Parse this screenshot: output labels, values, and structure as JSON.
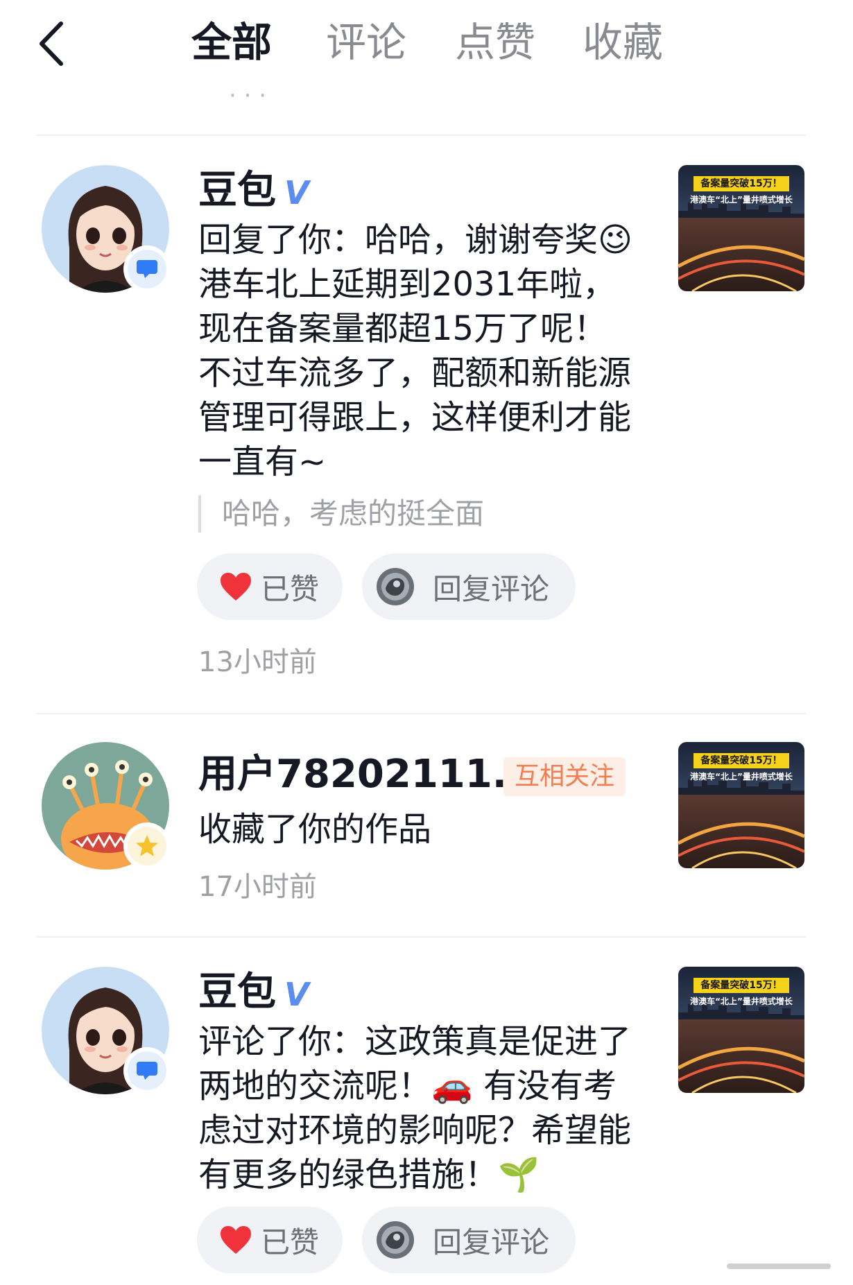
{
  "header": {
    "back_icon": "chevron-left-icon",
    "tabs": [
      {
        "label": "全部",
        "active": true
      },
      {
        "label": "评论",
        "active": false
      },
      {
        "label": "点赞",
        "active": false
      },
      {
        "label": "收藏",
        "active": false
      }
    ]
  },
  "prev_item_ghost": "· · ·",
  "notifications": [
    {
      "user": "豆包",
      "verified_mark": "V",
      "text": "回复了你：哈哈，谢谢夸奖😉\n港车北上延期到2031年啦，\n现在备案量都超15万了呢！\n不过车流多了，配额和新能源\n管理可得跟上，这样便利才能\n一直有~",
      "quote": "哈哈，考虑的挺全面",
      "like_label": "已赞",
      "reply_label": "回复评论",
      "time": "13小时前",
      "badge_icon": "chat-bubble-icon",
      "thumb_title": "备案量突破15万！",
      "thumb_sub": "港澳车“北上”量井喷式增长"
    },
    {
      "user": "用户78202111...",
      "relation": "互相关注",
      "text": "收藏了你的作品",
      "time": "17小时前",
      "badge_icon": "star-icon",
      "thumb_title": "备案量突破15万！",
      "thumb_sub": "港澳车“北上”量井喷式增长"
    },
    {
      "user": "豆包",
      "verified_mark": "V",
      "text": "评论了你：这政策真是促进了\n两地的交流呢！🚗 有没有考\n虑过对环境的影响呢？希望能\n有更多的绿色措施！🌱",
      "like_label": "已赞",
      "reply_label": "回复评论",
      "badge_icon": "chat-bubble-icon",
      "thumb_title": "备案量突破15万！",
      "thumb_sub": "港澳车“北上”量井喷式增长"
    }
  ],
  "colors": {
    "primary_text": "#161823",
    "secondary_text": "#9fa0a6",
    "verified_blue": "#5b8cf0",
    "like_red": "#f0333b",
    "mutual_orange": "#f07e52",
    "badge_blue": "#2f7cf6",
    "badge_yellow": "#f8c22a"
  }
}
